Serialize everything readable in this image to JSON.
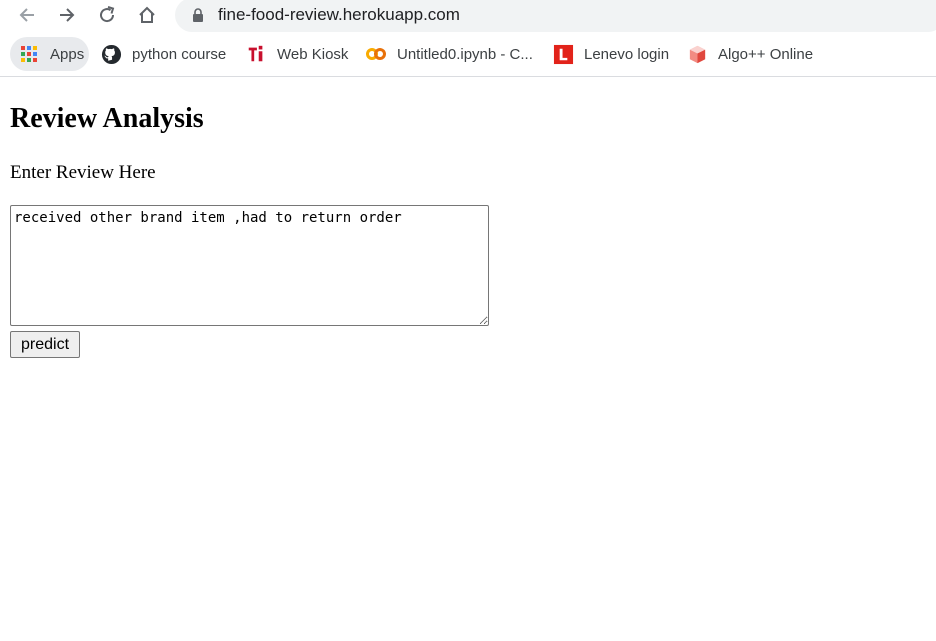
{
  "browser": {
    "url": "fine-food-review.herokuapp.com",
    "nav": {
      "back_icon": "arrow-left-icon",
      "forward_icon": "arrow-right-icon",
      "reload_icon": "reload-icon",
      "home_icon": "home-icon"
    },
    "bookmarks": [
      {
        "label": "Apps",
        "icon": "apps-grid-icon"
      },
      {
        "label": "python course",
        "icon": "github-icon"
      },
      {
        "label": "Web Kiosk",
        "icon": "ti-logo-icon"
      },
      {
        "label": "Untitled0.ipynb - C...",
        "icon": "colab-icon"
      },
      {
        "label": "Lenevo login",
        "icon": "l-logo-icon"
      },
      {
        "label": "Algo++ Online",
        "icon": "cube-icon"
      }
    ]
  },
  "page": {
    "title": "Review Analysis",
    "input_label": "Enter Review Here",
    "review_text": "received other brand item ,had to return order",
    "predict_label": "predict"
  },
  "colors": {
    "omnibox_bg": "#f1f3f4",
    "apps_chip_bg": "#e8eaed",
    "button_bg": "#efefef",
    "ti_red": "#c8102e",
    "colab_orange": "#f9ab00",
    "lenevo_red": "#e2231a"
  }
}
